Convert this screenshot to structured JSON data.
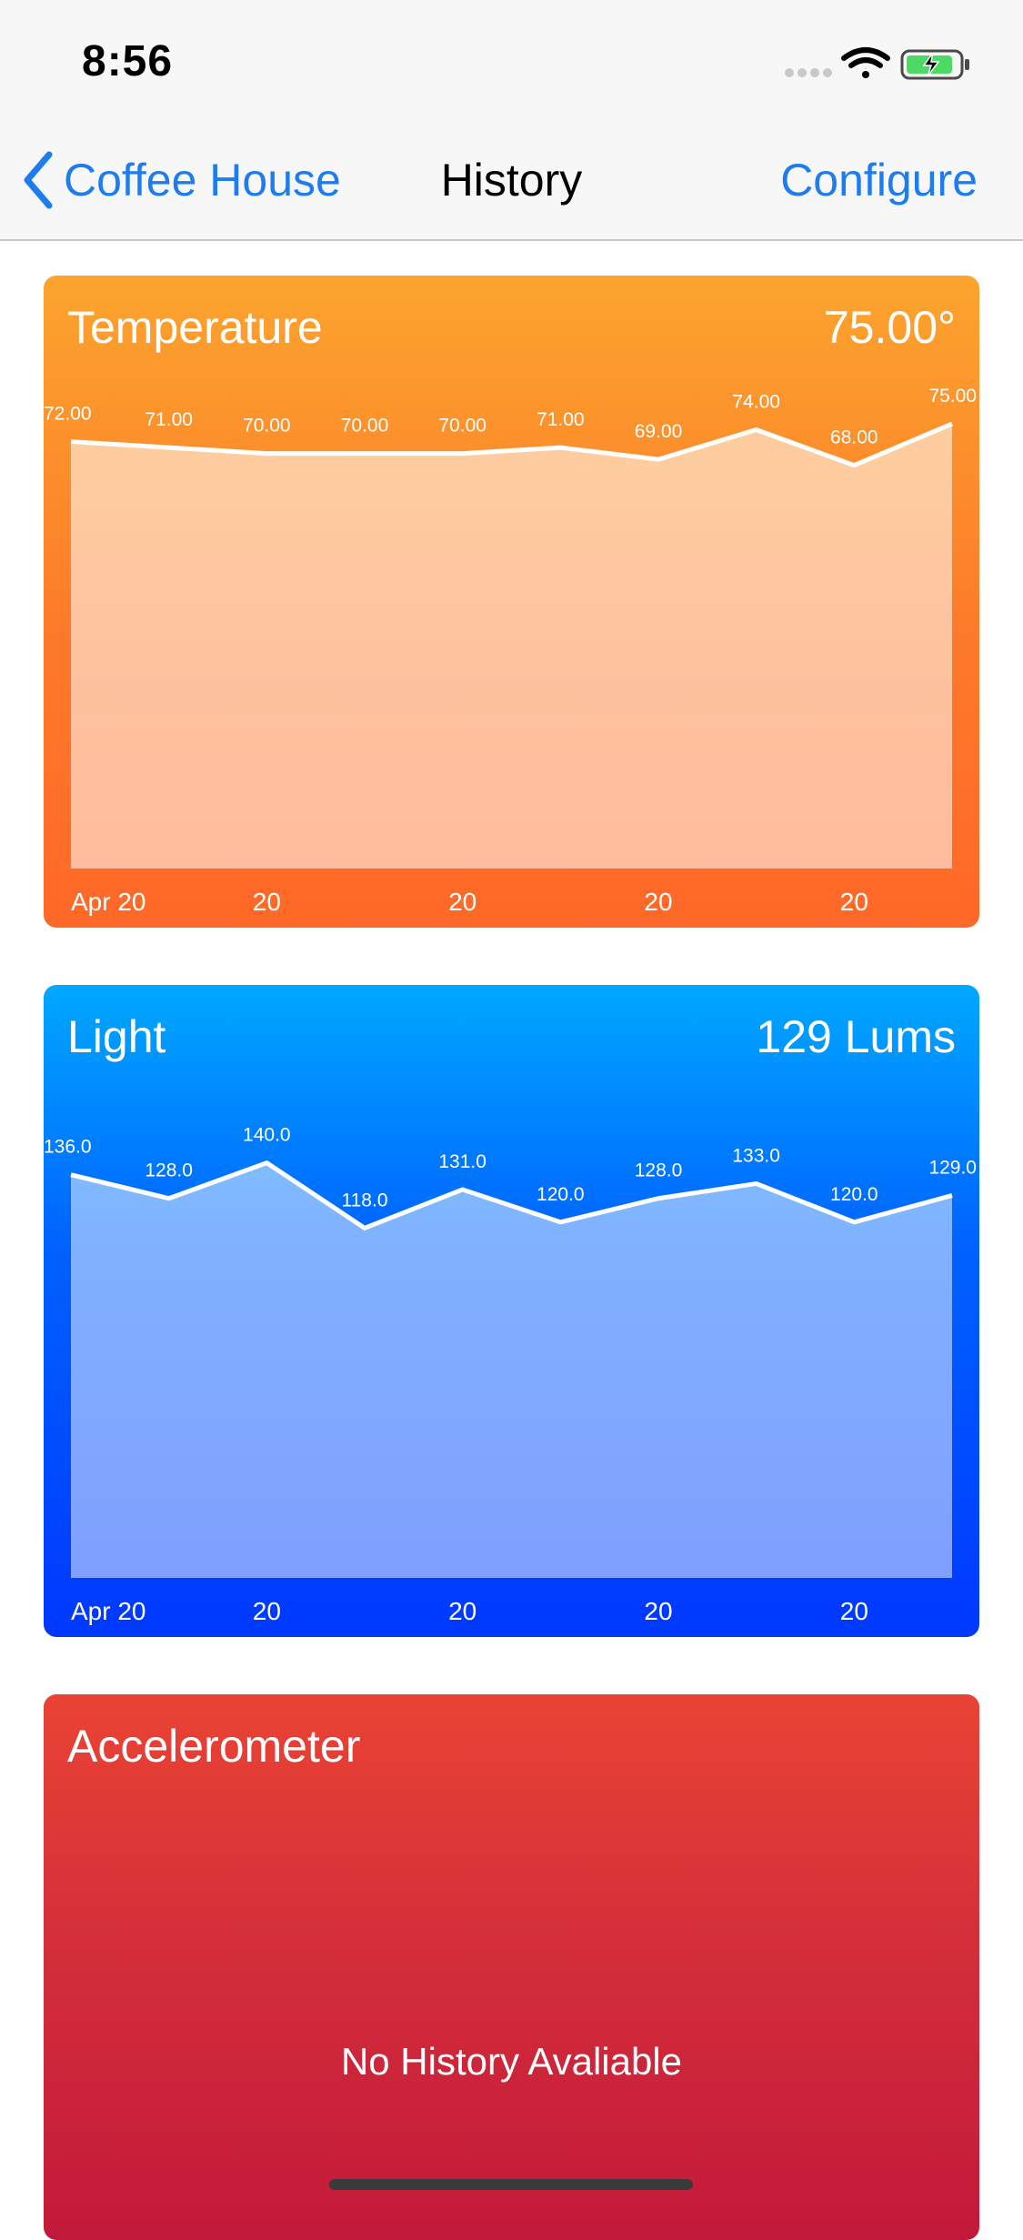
{
  "status_bar": {
    "time": "8:56",
    "icons": [
      "signal-dots-icon",
      "wifi-icon",
      "battery-charging-icon"
    ],
    "battery_color": "#4cd964"
  },
  "nav": {
    "back_label": "Coffee House",
    "title": "History",
    "configure_label": "Configure",
    "tint_color": "#1c7cf0"
  },
  "cards": {
    "temperature": {
      "title": "Temperature",
      "current_value": "75.00°",
      "chart_data": {
        "type": "area",
        "series": [
          {
            "values": [
              72.0,
              71.0,
              70.0,
              70.0,
              70.0,
              71.0,
              69.0,
              74.0,
              68.0,
              75.0
            ],
            "value_labels": [
              "72.00",
              "71.00",
              "70.00",
              "70.00",
              "70.00",
              "71.00",
              "69.00",
              "74.00",
              "68.00",
              "75.00"
            ]
          }
        ],
        "x_tick_labels": [
          "Apr 20",
          "20",
          "20",
          "20",
          "20"
        ],
        "ylim": [
          0,
          100
        ]
      }
    },
    "light": {
      "title": "Light",
      "current_value": "129 Lums",
      "chart_data": {
        "type": "area",
        "series": [
          {
            "values": [
              136.0,
              128.0,
              140.0,
              118.0,
              131.0,
              120.0,
              128.0,
              133.0,
              120.0,
              129.0
            ],
            "value_labels": [
              "136.0",
              "128.0",
              "140.0",
              "118.0",
              "131.0",
              "120.0",
              "128.0",
              "133.0",
              "120.0",
              "129.0"
            ]
          }
        ],
        "x_tick_labels": [
          "Apr 20",
          "20",
          "20",
          "20",
          "20"
        ],
        "ylim": [
          0,
          200
        ]
      }
    },
    "accelerometer": {
      "title": "Accelerometer",
      "empty_message": "No History Avaliable"
    }
  }
}
